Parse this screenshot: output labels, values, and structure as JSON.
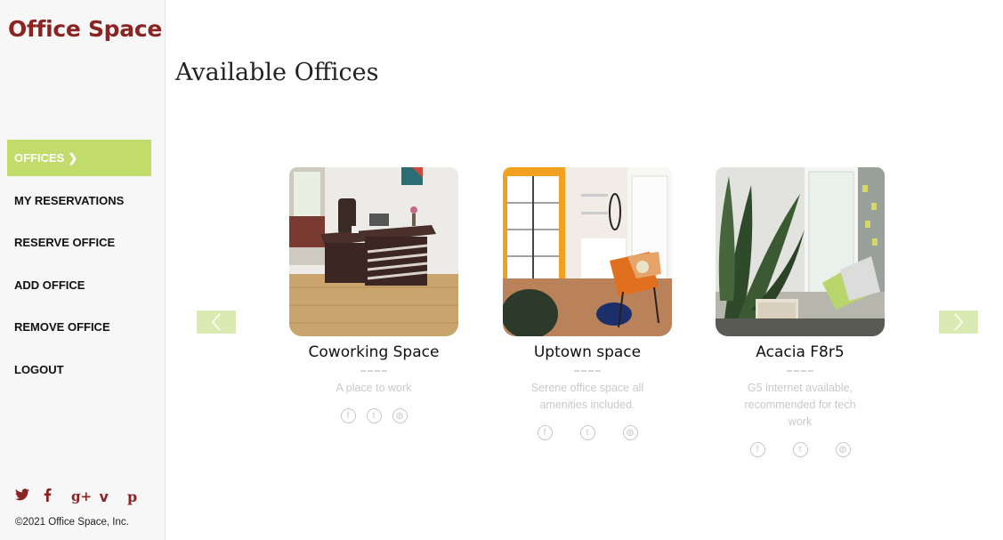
{
  "brand": "Office Space",
  "nav": {
    "items": [
      {
        "label": "OFFICES",
        "active": true
      },
      {
        "label": "MY RESERVATIONS"
      },
      {
        "label": "RESERVE OFFICE"
      },
      {
        "label": "ADD OFFICE"
      },
      {
        "label": "REMOVE OFFICE"
      },
      {
        "label": "LOGOUT"
      }
    ],
    "active_chevron": "❯"
  },
  "social": [
    "twitter-icon",
    "facebook-icon",
    "google-plus-icon",
    "vimeo-icon",
    "pinterest-icon"
  ],
  "social_glyphs": [
    "🐦",
    "f",
    "g+",
    "v",
    "p"
  ],
  "copyright": "©2021 Office Space, Inc.",
  "main": {
    "title": "Available Offices"
  },
  "offices": [
    {
      "name": "Coworking Space",
      "description": "A place to work"
    },
    {
      "name": "Uptown space",
      "description": "Serene office space all amenities included."
    },
    {
      "name": "Acacia F8r5",
      "description": "G5 internet available, recommended for tech work"
    }
  ],
  "colors": {
    "brand": "#8b2323",
    "accent": "#c1dc6a",
    "arrow_bg": "#d9ebb2"
  }
}
